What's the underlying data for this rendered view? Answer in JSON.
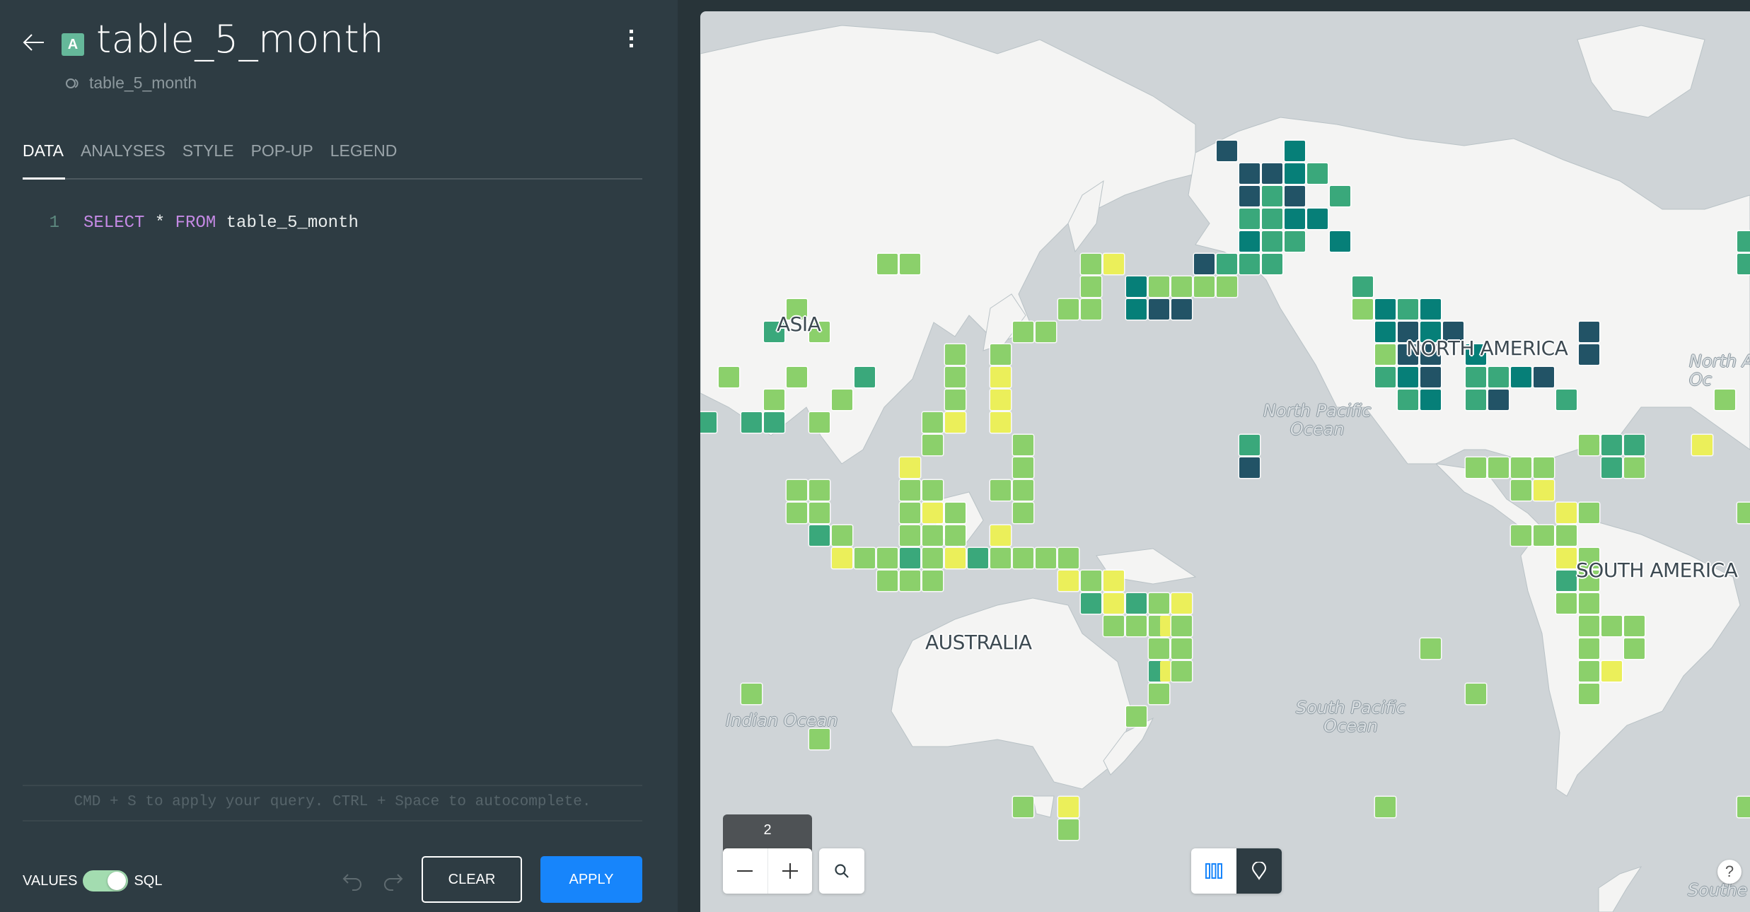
{
  "header": {
    "title": "table_5_month",
    "badge_letter": "A",
    "source_name": "table_5_month"
  },
  "tabs": [
    {
      "label": "DATA",
      "active": true
    },
    {
      "label": "ANALYSES",
      "active": false
    },
    {
      "label": "STYLE",
      "active": false
    },
    {
      "label": "POP-UP",
      "active": false
    },
    {
      "label": "LEGEND",
      "active": false
    }
  ],
  "editor": {
    "line_number": "1",
    "keyword_select": "SELECT",
    "star": " * ",
    "keyword_from": "FROM",
    "table": " table_5_month",
    "hint": "CMD + S to apply your query. CTRL + Space to autocomplete."
  },
  "footer": {
    "values_label": "VALUES",
    "sql_label": "SQL",
    "sql_mode_on": true,
    "clear_label": "CLEAR",
    "apply_label": "APPLY"
  },
  "map": {
    "zoom_level": "2",
    "help_label": "?",
    "labels": {
      "asia": "ASIA",
      "north_america": "NORTH AMERICA",
      "south_america": "SOUTH AMERICA",
      "australia": "AUSTRALIA",
      "north_pacific": "North Pacific\nOcean",
      "south_pacific": "South Pacific\nOcean",
      "indian": "Indian Ocean",
      "north_atlantic": "North A\nOc",
      "southern": "Southe"
    },
    "palette": {
      "Y": "#ebef5a",
      "LG": "#8bd06b",
      "M": "#3aa87b",
      "T": "#067f78",
      "D": "#225366"
    },
    "cells": [
      [
        22,
        6,
        "D"
      ],
      [
        25,
        6,
        "T"
      ],
      [
        23,
        7,
        "D"
      ],
      [
        24,
        7,
        "D"
      ],
      [
        25,
        7,
        "T"
      ],
      [
        26,
        7,
        "M"
      ],
      [
        23,
        8,
        "D"
      ],
      [
        24,
        8,
        "M"
      ],
      [
        25,
        8,
        "D"
      ],
      [
        27,
        8,
        "M"
      ],
      [
        23,
        9,
        "M"
      ],
      [
        24,
        9,
        "M"
      ],
      [
        25,
        9,
        "T"
      ],
      [
        26,
        9,
        "T"
      ],
      [
        23,
        10,
        "T"
      ],
      [
        24,
        10,
        "M"
      ],
      [
        25,
        10,
        "M"
      ],
      [
        27,
        10,
        "T"
      ],
      [
        45,
        10,
        "M"
      ],
      [
        7,
        11,
        "LG"
      ],
      [
        8,
        11,
        "LG"
      ],
      [
        16,
        11,
        "LG"
      ],
      [
        17,
        11,
        "Y"
      ],
      [
        21,
        11,
        "D"
      ],
      [
        22,
        11,
        "M"
      ],
      [
        23,
        11,
        "M"
      ],
      [
        24,
        11,
        "M"
      ],
      [
        45,
        11,
        "M"
      ],
      [
        16,
        12,
        "LG"
      ],
      [
        18,
        12,
        "T"
      ],
      [
        19,
        12,
        "LG"
      ],
      [
        20,
        12,
        "LG"
      ],
      [
        21,
        12,
        "LG"
      ],
      [
        22,
        12,
        "LG"
      ],
      [
        28,
        12,
        "M"
      ],
      [
        3,
        13,
        "LG"
      ],
      [
        15,
        13,
        "LG"
      ],
      [
        16,
        13,
        "LG"
      ],
      [
        18,
        13,
        "T"
      ],
      [
        19,
        13,
        "D"
      ],
      [
        20,
        13,
        "D"
      ],
      [
        28,
        13,
        "LG"
      ],
      [
        29,
        13,
        "T"
      ],
      [
        30,
        13,
        "M"
      ],
      [
        31,
        13,
        "T"
      ],
      [
        2,
        14,
        "M"
      ],
      [
        4,
        14,
        "LG"
      ],
      [
        13,
        14,
        "LG"
      ],
      [
        14,
        14,
        "LG"
      ],
      [
        29,
        14,
        "T"
      ],
      [
        30,
        14,
        "D"
      ],
      [
        31,
        14,
        "T"
      ],
      [
        32,
        14,
        "D"
      ],
      [
        38,
        14,
        "D"
      ],
      [
        10,
        15,
        "LG"
      ],
      [
        12,
        15,
        "LG"
      ],
      [
        29,
        15,
        "LG"
      ],
      [
        30,
        15,
        "D"
      ],
      [
        31,
        15,
        "D"
      ],
      [
        33,
        15,
        "T"
      ],
      [
        38,
        15,
        "D"
      ],
      [
        0,
        16,
        "LG"
      ],
      [
        3,
        16,
        "LG"
      ],
      [
        6,
        16,
        "M"
      ],
      [
        10,
        16,
        "LG"
      ],
      [
        12,
        16,
        "Y"
      ],
      [
        29,
        16,
        "M"
      ],
      [
        30,
        16,
        "T"
      ],
      [
        31,
        16,
        "D"
      ],
      [
        33,
        16,
        "M"
      ],
      [
        34,
        16,
        "M"
      ],
      [
        35,
        16,
        "T"
      ],
      [
        36,
        16,
        "D"
      ],
      [
        2,
        17,
        "LG"
      ],
      [
        5,
        17,
        "LG"
      ],
      [
        10,
        17,
        "LG"
      ],
      [
        12,
        17,
        "Y"
      ],
      [
        30,
        17,
        "M"
      ],
      [
        31,
        17,
        "T"
      ],
      [
        33,
        17,
        "M"
      ],
      [
        34,
        17,
        "D"
      ],
      [
        37,
        17,
        "M"
      ],
      [
        44,
        17,
        "LG"
      ],
      [
        -1,
        18,
        "M"
      ],
      [
        1,
        18,
        "M"
      ],
      [
        2,
        18,
        "M"
      ],
      [
        4,
        18,
        "LG"
      ],
      [
        9,
        18,
        "LG"
      ],
      [
        10,
        18,
        "Y"
      ],
      [
        12,
        18,
        "Y"
      ],
      [
        9,
        19,
        "LG"
      ],
      [
        13,
        19,
        "LG"
      ],
      [
        23,
        19,
        "M"
      ],
      [
        38,
        19,
        "LG"
      ],
      [
        39,
        19,
        "M"
      ],
      [
        40,
        19,
        "M"
      ],
      [
        43,
        19,
        "Y"
      ],
      [
        8,
        20,
        "Y"
      ],
      [
        13,
        20,
        "LG"
      ],
      [
        23,
        20,
        "D"
      ],
      [
        33,
        20,
        "LG"
      ],
      [
        34,
        20,
        "LG"
      ],
      [
        35,
        20,
        "LG"
      ],
      [
        36,
        20,
        "LG"
      ],
      [
        39,
        20,
        "M"
      ],
      [
        40,
        20,
        "LG"
      ],
      [
        3,
        21,
        "LG"
      ],
      [
        4,
        21,
        "LG"
      ],
      [
        8,
        21,
        "LG"
      ],
      [
        9,
        21,
        "LG"
      ],
      [
        12,
        21,
        "LG"
      ],
      [
        13,
        21,
        "LG"
      ],
      [
        35,
        21,
        "LG"
      ],
      [
        36,
        21,
        "Y"
      ],
      [
        3,
        22,
        "LG"
      ],
      [
        4,
        22,
        "LG"
      ],
      [
        8,
        22,
        "LG"
      ],
      [
        9,
        22,
        "Y"
      ],
      [
        10,
        22,
        "LG"
      ],
      [
        13,
        22,
        "LG"
      ],
      [
        37,
        22,
        "Y"
      ],
      [
        38,
        22,
        "LG"
      ],
      [
        45,
        22,
        "LG"
      ],
      [
        4,
        23,
        "M"
      ],
      [
        5,
        23,
        "LG"
      ],
      [
        8,
        23,
        "LG"
      ],
      [
        9,
        23,
        "LG"
      ],
      [
        10,
        23,
        "LG"
      ],
      [
        12,
        23,
        "Y"
      ],
      [
        35,
        23,
        "LG"
      ],
      [
        36,
        23,
        "LG"
      ],
      [
        37,
        23,
        "LG"
      ],
      [
        5,
        24,
        "Y"
      ],
      [
        6,
        24,
        "LG"
      ],
      [
        7,
        24,
        "LG"
      ],
      [
        8,
        24,
        "M"
      ],
      [
        9,
        24,
        "LG"
      ],
      [
        10,
        24,
        "Y"
      ],
      [
        11,
        24,
        "M"
      ],
      [
        12,
        24,
        "LG"
      ],
      [
        13,
        24,
        "LG"
      ],
      [
        14,
        24,
        "LG"
      ],
      [
        15,
        24,
        "LG"
      ],
      [
        37,
        24,
        "Y"
      ],
      [
        38,
        24,
        "LG"
      ],
      [
        7,
        25,
        "LG"
      ],
      [
        8,
        25,
        "LG"
      ],
      [
        9,
        25,
        "LG"
      ],
      [
        15,
        25,
        "Y"
      ],
      [
        16,
        25,
        "LG"
      ],
      [
        17,
        25,
        "Y"
      ],
      [
        37,
        25,
        "M"
      ],
      [
        38,
        25,
        "LG"
      ],
      [
        16,
        26,
        "M"
      ],
      [
        17,
        26,
        "Y"
      ],
      [
        18,
        26,
        "M"
      ],
      [
        19,
        26,
        "LG"
      ],
      [
        20,
        26,
        "Y"
      ],
      [
        37,
        26,
        "LG"
      ],
      [
        38,
        26,
        "LG"
      ],
      [
        17,
        27,
        "LG"
      ],
      [
        18,
        27,
        "LG"
      ],
      [
        19,
        27,
        "LG"
      ],
      [
        19.5,
        27,
        "Y"
      ],
      [
        20,
        27,
        "LG"
      ],
      [
        38,
        27,
        "LG"
      ],
      [
        39,
        27,
        "LG"
      ],
      [
        40,
        27,
        "LG"
      ],
      [
        19,
        28,
        "LG"
      ],
      [
        20,
        28,
        "LG"
      ],
      [
        31,
        28,
        "LG"
      ],
      [
        38,
        28,
        "LG"
      ],
      [
        40,
        28,
        "LG"
      ],
      [
        19,
        29,
        "M"
      ],
      [
        19.5,
        29,
        "Y"
      ],
      [
        20,
        29,
        "LG"
      ],
      [
        38,
        29,
        "LG"
      ],
      [
        39,
        29,
        "Y"
      ],
      [
        1,
        30,
        "LG"
      ],
      [
        19,
        30,
        "LG"
      ],
      [
        33,
        30,
        "LG"
      ],
      [
        38,
        30,
        "LG"
      ],
      [
        18,
        31,
        "LG"
      ],
      [
        4,
        32,
        "LG"
      ],
      [
        13,
        35,
        "LG"
      ],
      [
        15,
        35,
        "Y"
      ],
      [
        29,
        35,
        "LG"
      ],
      [
        45,
        35,
        "LG"
      ],
      [
        15,
        36,
        "LG"
      ]
    ]
  }
}
